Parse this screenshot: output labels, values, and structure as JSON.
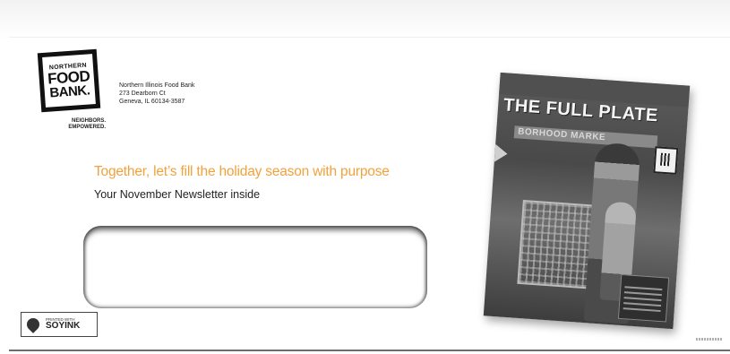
{
  "sender": {
    "logo": {
      "line1": "NORTHERN",
      "line2": "FOOD",
      "line3": "BANK."
    },
    "tagline_line1": "NEIGHBORS.",
    "tagline_line2": "EMPOWERED.",
    "name": "Northern Illinois Food Bank",
    "street": "273 Dearborn Ct",
    "city": "Geneva, IL 60134-3587"
  },
  "headline": "Together, let’s fill the holiday season with purpose",
  "subheadline": "Your November Newsletter inside",
  "soy_ink": {
    "line1": "PRINTED WITH",
    "line2": "SOYINK"
  },
  "newsletter_cover": {
    "title": "THE FULL PLATE",
    "sign_text": "BORHOOD MARKE"
  },
  "colors": {
    "headline": "#f0a23c",
    "text": "#222222"
  }
}
